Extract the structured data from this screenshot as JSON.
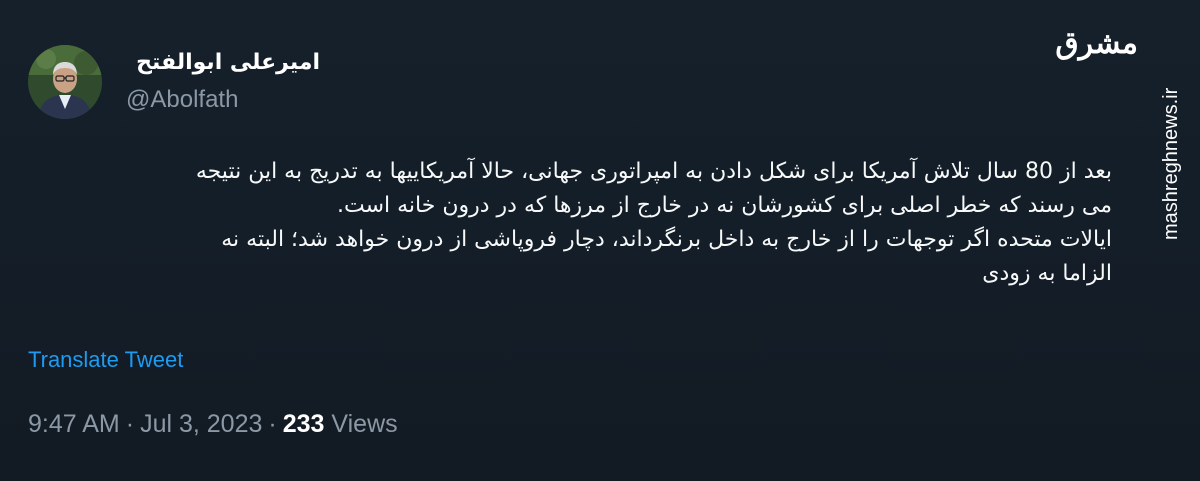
{
  "author": {
    "name": "امیرعلی ابوالفتح",
    "handle": "@Abolfath"
  },
  "watermark": {
    "logo_text": "مشرق",
    "site": "mashreghnews.ir"
  },
  "tweet": {
    "lines": [
      "بعد از 80 سال تلاش آمریکا برای شکل دادن به امپراتوری جهانی، حالا آمریکاییها به تدریج به این نتیجه",
      "می رسند که خطر اصلی برای کشورشان نه در خارج از مرزها که در درون خانه است.",
      "ایالات متحده اگر توجهات را از خارج به داخل برنگرداند، دچار فروپاشی از درون خواهد شد؛ البته نه",
      "الزاما به زودی"
    ],
    "translate_label": "Translate Tweet"
  },
  "meta": {
    "time": "9:47 AM",
    "date": "Jul 3, 2023",
    "separator": "·",
    "views_count": "233",
    "views_label": "Views"
  },
  "colors": {
    "background": "#15202b",
    "text": "#f7f9f9",
    "secondary": "#8b98a5",
    "link": "#1d9bf0"
  }
}
